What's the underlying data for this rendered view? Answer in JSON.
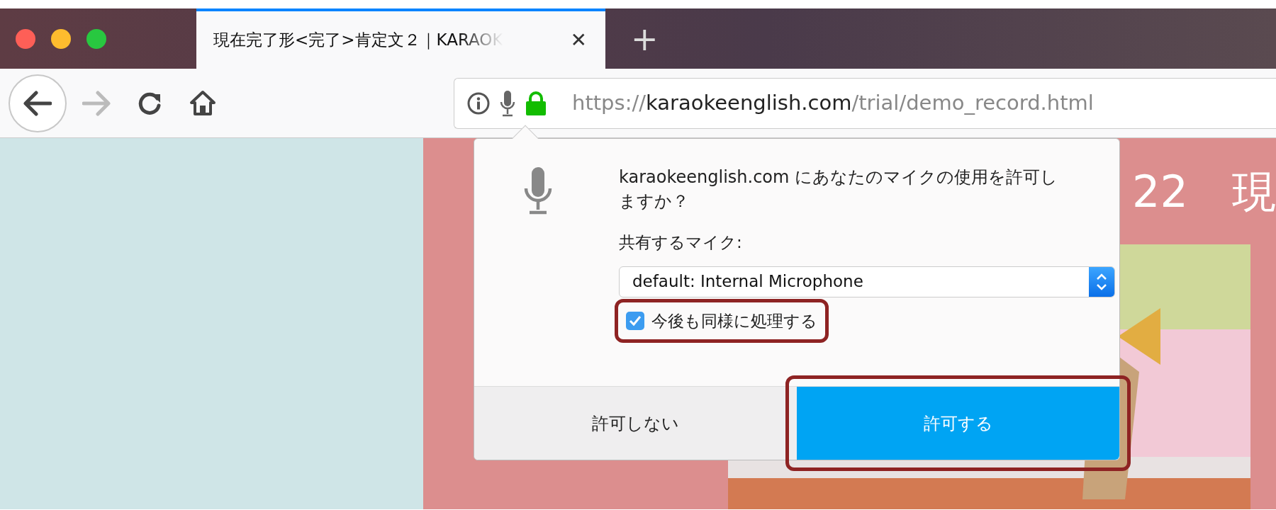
{
  "window": {
    "tabs": [
      {
        "title": "現在完了形<完了>肯定文２｜KARAOK",
        "close": "✕",
        "selected": true
      }
    ],
    "new_tab": "+"
  },
  "toolbar": {
    "back_enabled": true,
    "forward_enabled": false,
    "url": {
      "scheme": "https://",
      "domain": "karaokeenglish.com",
      "path": "/trial/demo_record.html"
    }
  },
  "page": {
    "heading": "22　現"
  },
  "permission_popup": {
    "message": "karaokeenglish.com にあなたのマイクの使用を許可しますか？",
    "device_label": "共有するマイク:",
    "device_select": {
      "value": "default: Internal Microphone"
    },
    "remember": {
      "label": "今後も同様に処理する",
      "checked": true,
      "highlighted": true
    },
    "buttons": [
      {
        "label": "許可しない",
        "kind": "secondary"
      },
      {
        "label": "許可する",
        "kind": "primary",
        "highlighted": true
      }
    ]
  }
}
